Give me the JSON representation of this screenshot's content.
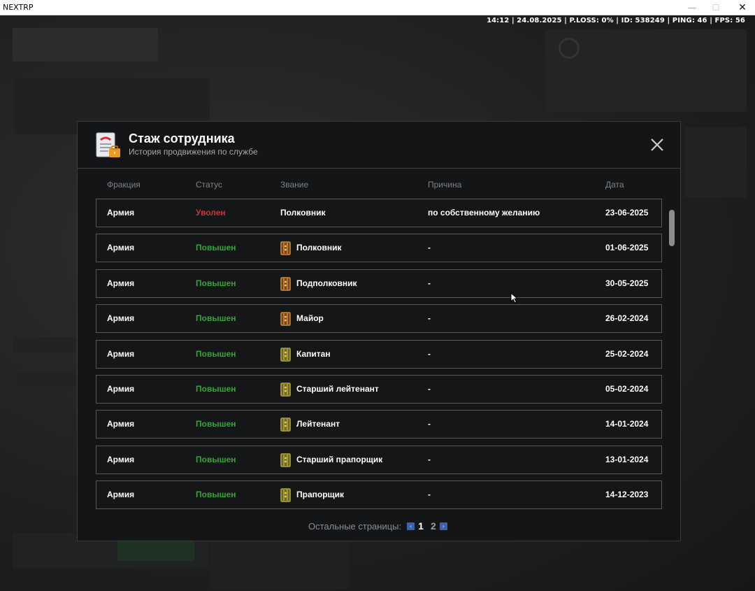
{
  "window": {
    "title": "NEXTRP",
    "controls": {
      "minimize": "—",
      "maximize": "☐",
      "close": "✕"
    }
  },
  "hud": {
    "info": "14:12 | 24.08.2025 | P.LOSS: 0% | ID: 538249 | PING: 46 | FPS: 56"
  },
  "modal": {
    "title": "Стаж сотрудника",
    "subtitle": "История продвижения по службе",
    "close_icon": "close-icon",
    "columns": {
      "faction": "Фракция",
      "status": "Статус",
      "rank": "Звание",
      "reason": "Причина",
      "date": "Дата"
    },
    "rows": [
      {
        "faction": "Армия",
        "status": "Уволен",
        "status_type": "fired",
        "rank": "Полковник",
        "has_icon": false,
        "reason": "по собственному желанию",
        "date": "23-06-2025"
      },
      {
        "faction": "Армия",
        "status": "Повышен",
        "status_type": "promoted",
        "rank": "Полковник",
        "has_icon": true,
        "icon_color": "#8b3a24",
        "reason": "-",
        "date": "01-06-2025"
      },
      {
        "faction": "Армия",
        "status": "Повышен",
        "status_type": "promoted",
        "rank": "Подполковник",
        "has_icon": true,
        "icon_color": "#8b3a24",
        "reason": "-",
        "date": "30-05-2025"
      },
      {
        "faction": "Армия",
        "status": "Повышен",
        "status_type": "promoted",
        "rank": "Майор",
        "has_icon": true,
        "icon_color": "#8b3a24",
        "reason": "-",
        "date": "26-02-2024"
      },
      {
        "faction": "Армия",
        "status": "Повышен",
        "status_type": "promoted",
        "rank": "Капитан",
        "has_icon": true,
        "icon_color": "#6b6a2c",
        "reason": "-",
        "date": "25-02-2024"
      },
      {
        "faction": "Армия",
        "status": "Повышен",
        "status_type": "promoted",
        "rank": "Старший лейтенант",
        "has_icon": true,
        "icon_color": "#6b6a2c",
        "reason": "-",
        "date": "05-02-2024"
      },
      {
        "faction": "Армия",
        "status": "Повышен",
        "status_type": "promoted",
        "rank": "Лейтенант",
        "has_icon": true,
        "icon_color": "#6b6a2c",
        "reason": "-",
        "date": "14-01-2024"
      },
      {
        "faction": "Армия",
        "status": "Повышен",
        "status_type": "promoted",
        "rank": "Старший прапорщик",
        "has_icon": true,
        "icon_color": "#6b6a2c",
        "reason": "-",
        "date": "13-01-2024"
      },
      {
        "faction": "Армия",
        "status": "Повышен",
        "status_type": "promoted",
        "rank": "Прапорщик",
        "has_icon": true,
        "icon_color": "#6b6a2c",
        "reason": "-",
        "date": "14-12-2023"
      }
    ],
    "pager": {
      "label": "Остальные страницы:",
      "prev_icon": "‹",
      "next_icon": "›",
      "pages": [
        "1",
        "2"
      ],
      "current": "1"
    }
  },
  "colors": {
    "fired": "#c0393b",
    "promoted": "#32a635",
    "accent": "#3a62b0"
  }
}
